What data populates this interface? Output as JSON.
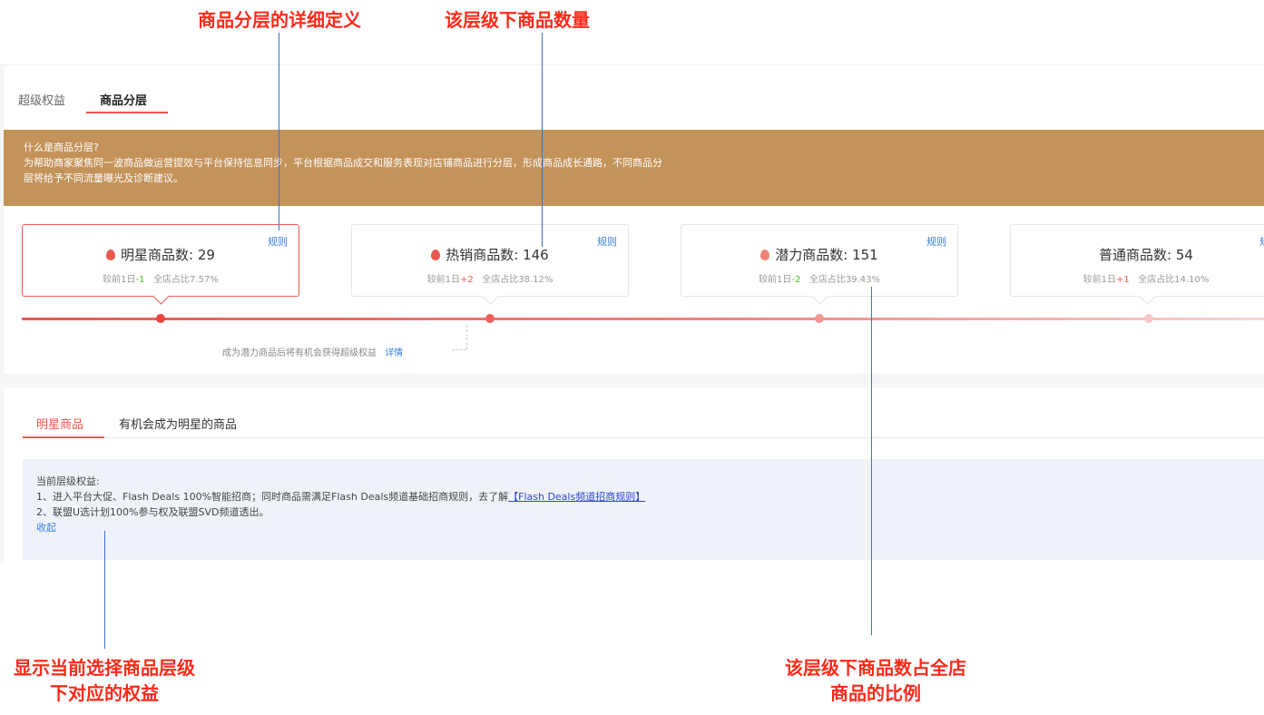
{
  "annotations": {
    "definition": "商品分层的详细定义",
    "count": "该层级下商品数量",
    "benefit": "显示当前选择商品层级下对应的权益",
    "ratio": "该层级下商品数占全店商品的比例"
  },
  "top_tabs": [
    {
      "label": "超级权益",
      "active": false
    },
    {
      "label": "商品分层",
      "active": true
    }
  ],
  "banner": {
    "title": "什么是商品分层?",
    "line1": "为帮助商家聚焦同一波商品做运营提效与平台保持信息同步，平台根据商品成交和服务表现对店铺商品进行分层，形成商品成长通路，不同商品分",
    "line2": "层将给予不同流量曝光及诊断建议。"
  },
  "levels": [
    {
      "title": "明星商品数: 29",
      "compare_label": "较前1日",
      "delta": "-1",
      "share": "全店占比7.57%",
      "rule": "规则",
      "flame": true
    },
    {
      "title": "热销商品数: 146",
      "compare_label": "较前1日",
      "delta": "+2",
      "share": "全店占比38.12%",
      "rule": "规则",
      "flame": true
    },
    {
      "title": "潜力商品数: 151",
      "compare_label": "较前1日",
      "delta": "-2",
      "share": "全店占比39.43%",
      "rule": "规则",
      "flame": true
    },
    {
      "title": "普通商品数: 54",
      "compare_label": "较前1日",
      "delta": "+1",
      "share": "全店占比14.10%",
      "rule": "规则",
      "flame": false
    }
  ],
  "hint": {
    "text": "成为潜力商品后将有机会获得超级权益",
    "link": "详情"
  },
  "sub_tabs": [
    {
      "label": "明星商品",
      "active": true
    },
    {
      "label": "有机会成为明星的商品",
      "active": false
    }
  ],
  "benefit_panel": {
    "heading": "当前层级权益:",
    "item1_text": "1、进入平台大促、Flash Deals 100%智能招商；同时商品需满足Flash Deals频道基础招商规则，去了解",
    "item1_link": "【Flash Deals频道招商规则】",
    "item2": "2、联盟U选计划100%参与权及联盟SVD频道透出。",
    "collapse": "收起"
  },
  "colors": {
    "accent": "#ee5550",
    "banner": "#c4935a",
    "annotation": "#ff2a1a",
    "link": "#3b7fd9"
  }
}
